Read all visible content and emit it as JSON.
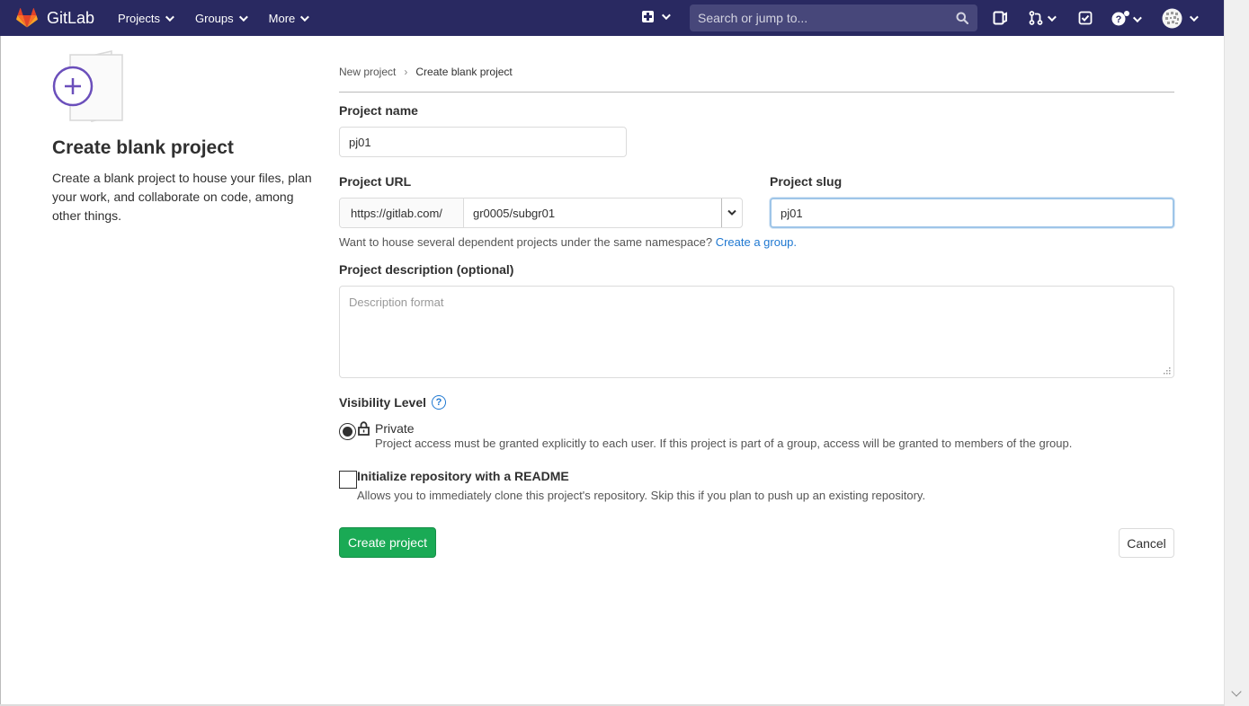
{
  "navbar": {
    "brand": "GitLab",
    "menu": [
      {
        "label": "Projects"
      },
      {
        "label": "Groups"
      },
      {
        "label": "More"
      }
    ],
    "search_placeholder": "Search or jump to...",
    "bg_color": "#292961"
  },
  "sidebar_info": {
    "title": "Create blank project",
    "description": "Create a blank project to house your files, plan your work, and collaborate on code, among other things."
  },
  "breadcrumb": {
    "parent": "New project",
    "separator": "›",
    "current": "Create blank project"
  },
  "form": {
    "project_name": {
      "label": "Project name",
      "value": "pj01"
    },
    "project_url": {
      "label": "Project URL",
      "prefix": "https://gitlab.com/",
      "namespace": "gr0005/subgr01"
    },
    "project_slug": {
      "label": "Project slug",
      "value": "pj01"
    },
    "namespace_help": {
      "text": "Want to house several dependent projects under the same namespace?",
      "link": "Create a group."
    },
    "description": {
      "label": "Project description (optional)",
      "placeholder": "Description format"
    },
    "visibility": {
      "label": "Visibility Level",
      "help_icon": "?",
      "option_title": "Private",
      "option_desc": "Project access must be granted explicitly to each user. If this project is part of a group, access will be granted to members of the group."
    },
    "readme": {
      "title": "Initialize repository with a README",
      "desc": "Allows you to immediately clone this project's repository. Skip this if you plan to push up an existing repository."
    },
    "create_button": "Create project",
    "cancel_button": "Cancel",
    "accent_color": "#1aaa55",
    "link_color": "#1f78d1"
  }
}
